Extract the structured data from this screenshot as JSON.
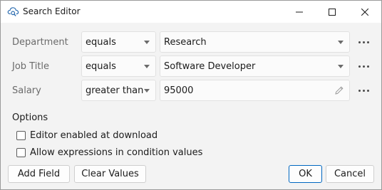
{
  "window": {
    "title": "Search Editor",
    "app_icon": "cloud-search-icon",
    "controls": [
      "minimize-icon",
      "maximize-icon",
      "close-icon"
    ]
  },
  "conditions": [
    {
      "field": "Department",
      "operator": "equals",
      "value": "Research",
      "value_kind": "dropdown"
    },
    {
      "field": "Job Title",
      "operator": "equals",
      "value": "Software Developer",
      "value_kind": "dropdown"
    },
    {
      "field": "Salary",
      "operator": "greater than",
      "value": "95000",
      "value_kind": "text"
    }
  ],
  "options": {
    "title": "Options",
    "checkboxes": [
      {
        "label": "Editor enabled at download",
        "checked": false
      },
      {
        "label": "Allow expressions in condition values",
        "checked": false
      }
    ]
  },
  "buttons": {
    "add_field": "Add Field",
    "clear_values": "Clear Values",
    "ok": "OK",
    "cancel": "Cancel"
  },
  "colors": {
    "accent": "#0067c0",
    "dialog_background": "#f3f3f3",
    "label_text": "#6b6b6b"
  }
}
